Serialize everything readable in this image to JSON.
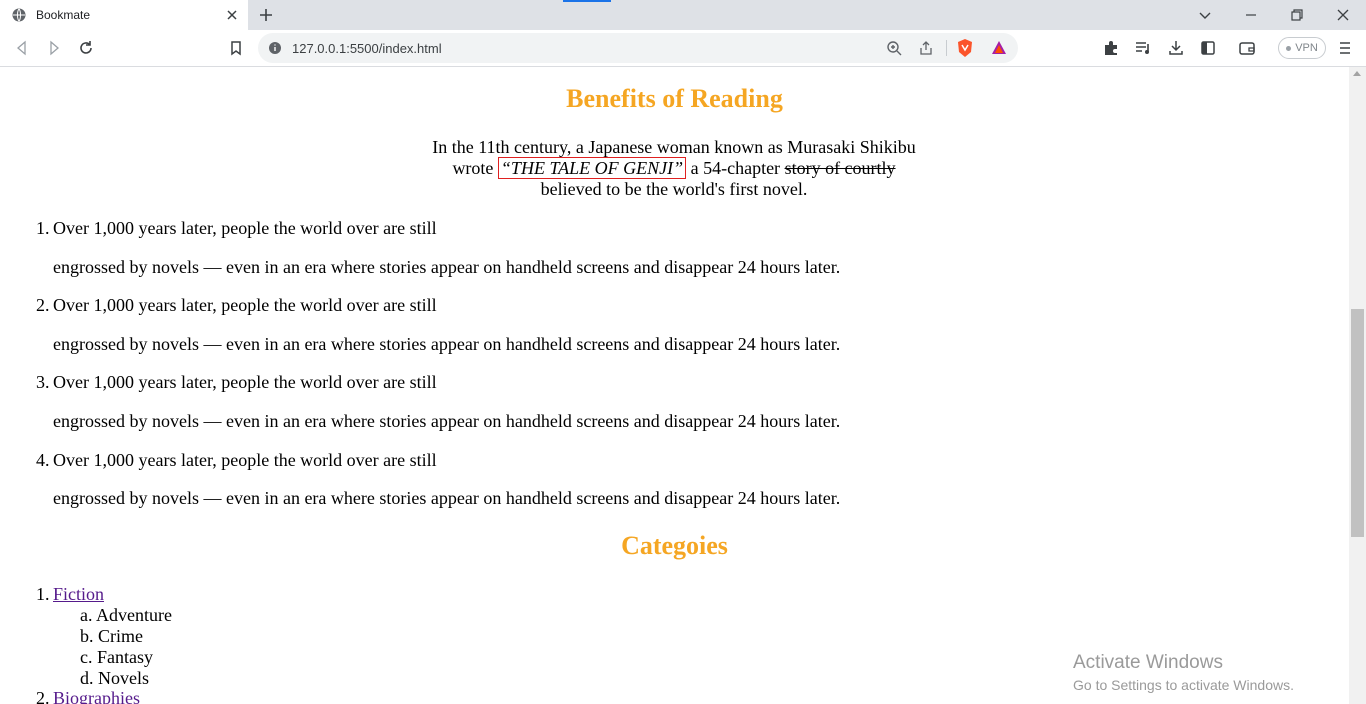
{
  "browser": {
    "tab_title": "Bookmate",
    "url": "127.0.0.1:5500/index.html",
    "vpn_label": "VPN",
    "icons": [
      "globe-icon",
      "close-icon",
      "plus-icon",
      "chevron-down-icon",
      "minimize-icon",
      "restore-icon",
      "window-close-icon",
      "back-icon",
      "forward-icon",
      "reload-icon",
      "bookmark-icon",
      "info-icon",
      "zoom-icon",
      "share-icon",
      "brave-shield-icon",
      "brave-rewards-icon",
      "extensions-icon",
      "playlist-icon",
      "download-icon",
      "sidebar-icon",
      "wallet-icon",
      "menu-icon"
    ]
  },
  "page": {
    "heading1": "Benefits of Reading",
    "intro": {
      "part1": "In the 11th century, a Japanese woman known as Murasaki Shikibu wrote ",
      "book_title": "“THE TALE OF GENJI”",
      "part2": " a 54-chapter ",
      "struck": "story of courtly",
      "part3": " believed to be the world's first novel."
    },
    "benefits": [
      {
        "num": "1.",
        "line1": "Over 1,000 years later, people the world over are still",
        "line2": "engrossed by novels — even in an era where stories appear on handheld screens and disappear 24 hours later."
      },
      {
        "num": "2.",
        "line1": "Over 1,000 years later, people the world over are still",
        "line2": "engrossed by novels — even in an era where stories appear on handheld screens and disappear 24 hours later."
      },
      {
        "num": "3.",
        "line1": "Over 1,000 years later, people the world over are still",
        "line2": "engrossed by novels — even in an era where stories appear on handheld screens and disappear 24 hours later."
      },
      {
        "num": "4.",
        "line1": "Over 1,000 years later, people the world over are still",
        "line2": "engrossed by novels — even in an era where stories appear on handheld screens and disappear 24 hours later."
      }
    ],
    "heading2": "Categoies",
    "categories": [
      {
        "num": "1.",
        "label": "Fiction",
        "subs": [
          {
            "marker": "a.",
            "label": "Adventure"
          },
          {
            "marker": "b.",
            "label": "Crime"
          },
          {
            "marker": "c.",
            "label": "Fantasy"
          },
          {
            "marker": "d.",
            "label": "Novels"
          }
        ]
      },
      {
        "num": "2.",
        "label": "Biographies"
      }
    ]
  },
  "os": {
    "activate_title": "Activate Windows",
    "activate_sub": "Go to Settings to activate Windows."
  },
  "colors": {
    "heading": "#f5a623",
    "visited_link": "#551a8b",
    "title_box": "#e02020"
  }
}
